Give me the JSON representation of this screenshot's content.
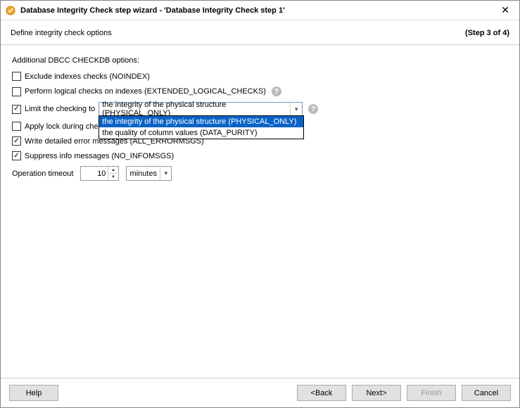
{
  "window": {
    "title": "Database Integrity Check step wizard - 'Database Integrity Check step 1'",
    "subtitle": "Define integrity check options",
    "step": "(Step 3 of 4)"
  },
  "section": {
    "heading": "Additional DBCC CHECKDB options:"
  },
  "options": {
    "exclude_indexes": {
      "checked": false,
      "label": "Exclude indexes checks (NOINDEX)"
    },
    "logical_checks": {
      "checked": false,
      "label": "Perform logical checks on indexes (EXTENDED_LOGICAL_CHECKS)"
    },
    "limit_checking": {
      "checked": true,
      "label": "Limit the checking to",
      "selected": "the integrity of the physical structure (PHYSICAL_ONLY)",
      "items": [
        "the integrity of the physical structure (PHYSICAL_ONLY)",
        "the quality of column values (DATA_PURITY)"
      ]
    },
    "apply_lock": {
      "checked": false,
      "label": "Apply lock during che"
    },
    "error_msgs": {
      "checked": true,
      "label": "Write detailed error messages (ALL_ERRORMSGS)"
    },
    "suppress_info": {
      "checked": true,
      "label": "Suppress info messages (NO_INFOMSGS)"
    }
  },
  "timeout": {
    "label": "Operation timeout",
    "value": "10",
    "unit": "minutes"
  },
  "buttons": {
    "help": "Help",
    "back": "<Back",
    "next": "Next>",
    "finish": "Finish",
    "cancel": "Cancel"
  }
}
